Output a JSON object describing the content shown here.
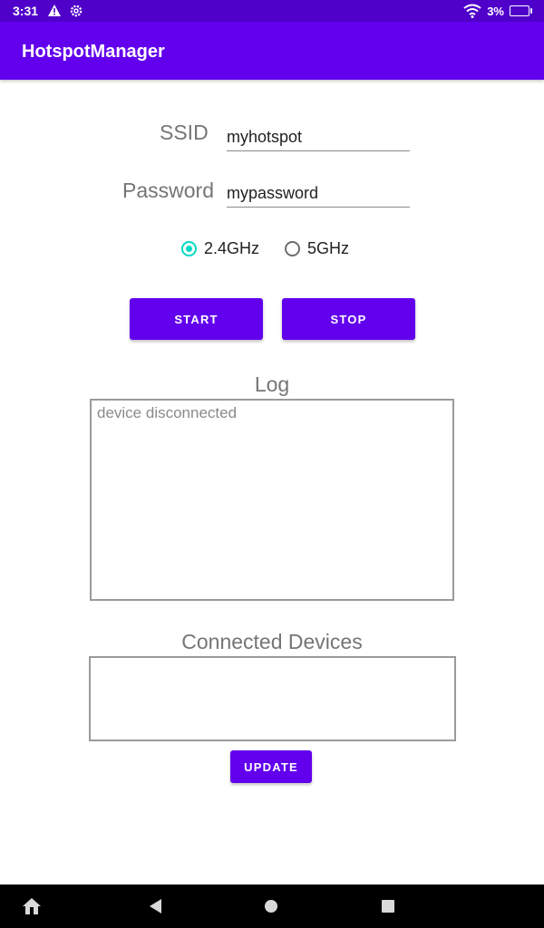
{
  "status": {
    "time": "3:31",
    "battery": "3%",
    "icons": [
      "warning-icon",
      "settings-icon",
      "wifi-icon",
      "battery-icon"
    ]
  },
  "appbar": {
    "title": "HotspotManager"
  },
  "form": {
    "ssid_label": "SSID",
    "ssid_value": "myhotspot",
    "password_label": "Password",
    "password_value": "mypassword",
    "band_options": [
      "2.4GHz",
      "5GHz"
    ],
    "selected_band": "2.4GHz"
  },
  "buttons": {
    "start": "START",
    "stop": "STOP",
    "update": "UPDATE"
  },
  "log": {
    "title": "Log",
    "text": "device disconnected"
  },
  "devices": {
    "title": "Connected Devices"
  },
  "colors": {
    "statusbar": "#4f00c9",
    "appbar": "#6200ee",
    "accent": "#03dac5",
    "button": "#6200ee"
  }
}
